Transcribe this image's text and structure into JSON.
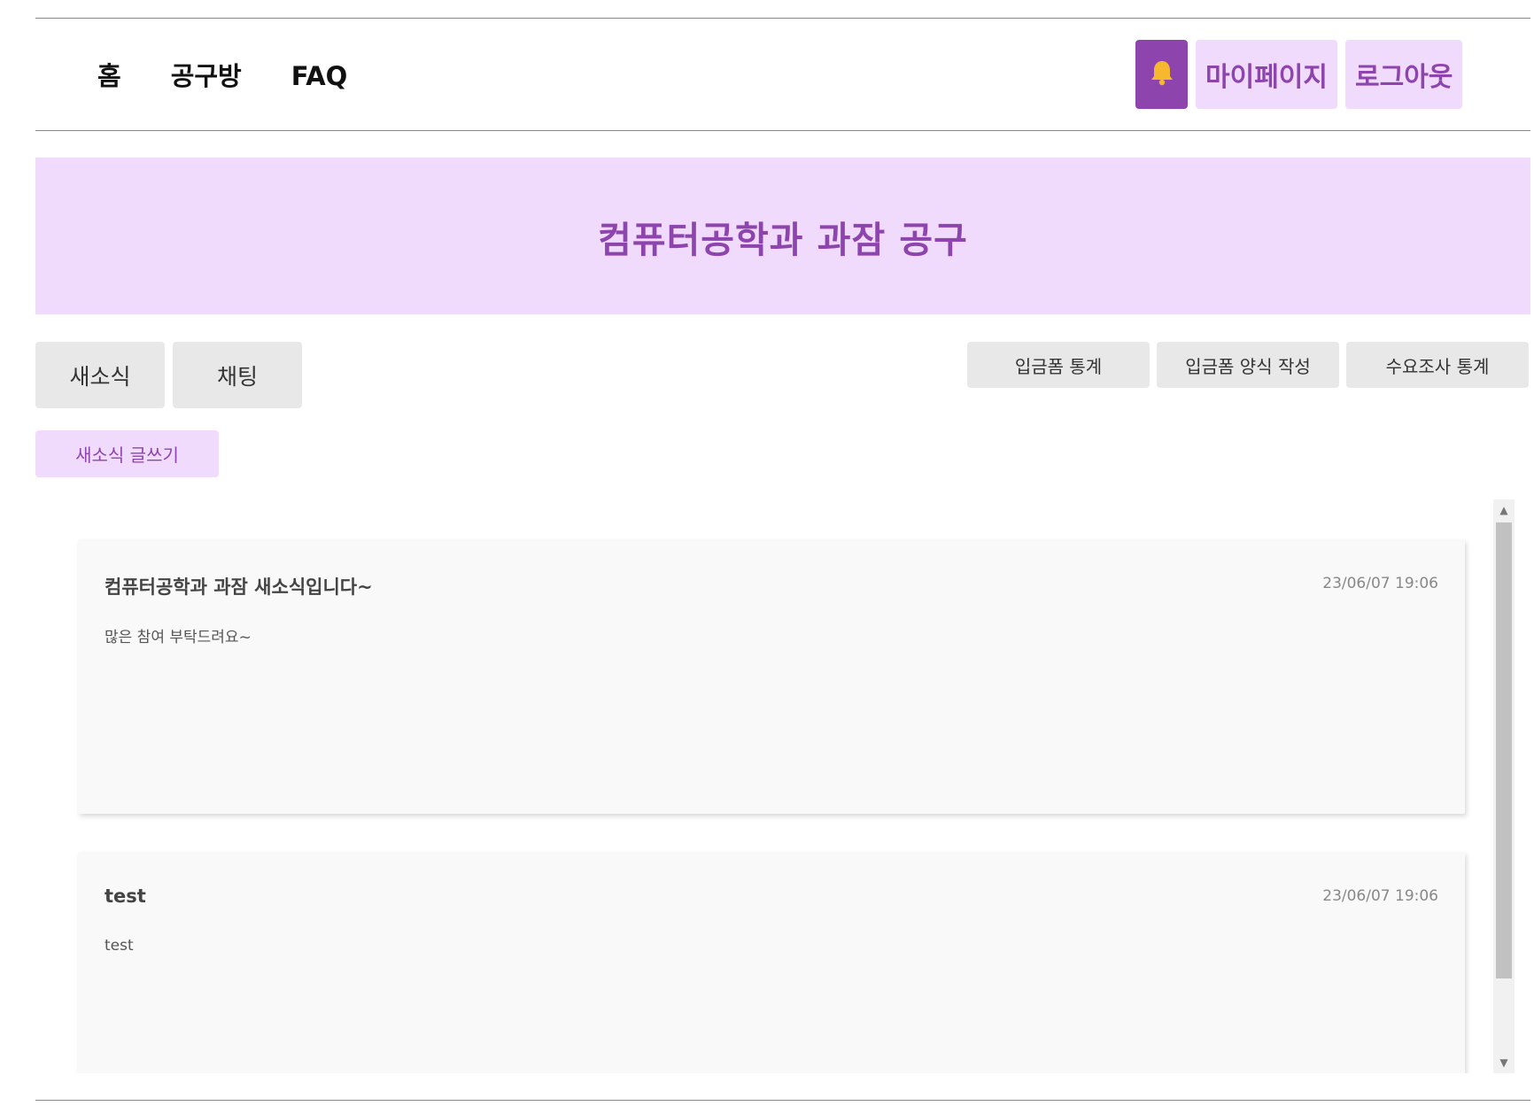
{
  "nav": {
    "items": [
      {
        "label": "홈"
      },
      {
        "label": "공구방"
      },
      {
        "label": "FAQ"
      }
    ]
  },
  "header": {
    "bell_icon": "bell-icon",
    "mypage_label": "마이페이지",
    "logout_label": "로그아웃",
    "accent_color": "#8e44ad",
    "accent_light": "#f0dbfd"
  },
  "banner": {
    "title": "컴퓨터공학과 과잠 공구"
  },
  "tabs": [
    {
      "label": "새소식"
    },
    {
      "label": "채팅"
    }
  ],
  "actions": [
    {
      "label": "입금폼 통계"
    },
    {
      "label": "입금폼 양식 작성"
    },
    {
      "label": "수요조사 통계"
    }
  ],
  "write_button": {
    "label": "새소식 글쓰기"
  },
  "posts": [
    {
      "title": "컴퓨터공학과 과잠 새소식입니다~",
      "date": "23/06/07 19:06",
      "body": "많은 참여 부탁드려요~"
    },
    {
      "title": "test",
      "date": "23/06/07 19:06",
      "body": "test"
    }
  ],
  "scrollbar": {
    "up_icon": "triangle-up-icon",
    "down_icon": "triangle-down-icon"
  }
}
